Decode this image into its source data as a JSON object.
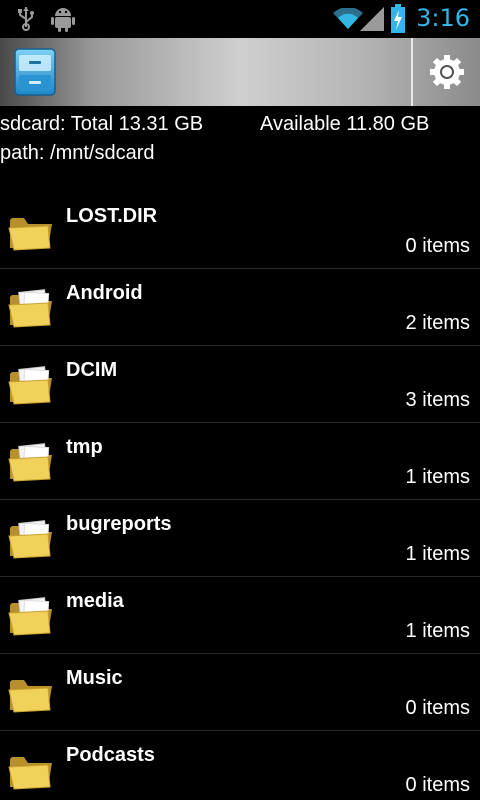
{
  "status_bar": {
    "time": "3:16",
    "icons": [
      "usb-icon",
      "android-debug-icon",
      "wifi-icon",
      "signal-icon",
      "battery-charging-icon"
    ]
  },
  "action_bar": {
    "app_icon": "file-cabinet-icon",
    "settings_icon": "gear-icon"
  },
  "storage": {
    "total_label": "sdcard: Total 13.31 GB",
    "available_label": "Available 11.80 GB",
    "path_label": "path: /mnt/sdcard"
  },
  "files": [
    {
      "name": "LOST.DIR",
      "count": "0 items",
      "icon": "folder-empty-icon"
    },
    {
      "name": "Android",
      "count": "2 items",
      "icon": "folder-with-files-icon"
    },
    {
      "name": "DCIM",
      "count": "3 items",
      "icon": "folder-with-files-icon"
    },
    {
      "name": "tmp",
      "count": "1 items",
      "icon": "folder-with-files-icon"
    },
    {
      "name": "bugreports",
      "count": "1 items",
      "icon": "folder-with-files-icon"
    },
    {
      "name": "media",
      "count": "1 items",
      "icon": "folder-with-files-icon"
    },
    {
      "name": "Music",
      "count": "0 items",
      "icon": "folder-empty-icon"
    },
    {
      "name": "Podcasts",
      "count": "0 items",
      "icon": "folder-empty-icon"
    }
  ],
  "colors": {
    "accent": "#33b5e5",
    "folder": "#e8c84a"
  }
}
